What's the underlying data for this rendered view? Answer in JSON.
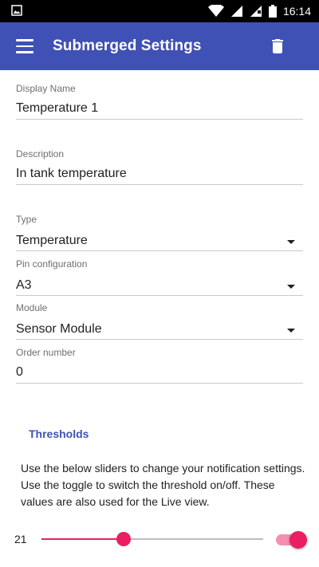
{
  "status_bar": {
    "time": "16:14"
  },
  "app_bar": {
    "title": "Submerged Settings",
    "menu_icon": "hamburger-menu-icon",
    "delete_icon": "trash-icon",
    "color": "#3f51b5"
  },
  "fields": {
    "display_name": {
      "label": "Display Name",
      "value": "Temperature 1"
    },
    "description": {
      "label": "Description",
      "value": "In tank temperature"
    },
    "type": {
      "label": "Type",
      "value": "Temperature"
    },
    "pin_configuration": {
      "label": "Pin configuration",
      "value": "A3"
    },
    "module": {
      "label": "Module",
      "value": "Sensor Module"
    },
    "order_number": {
      "label": "Order number",
      "value": "0"
    }
  },
  "thresholds": {
    "heading": "Thresholds",
    "help_text": "Use the below sliders to change your notification settings. Use the toggle to switch the threshold on/off. These values are also used for the Live view.",
    "slider": {
      "value": "21",
      "fraction": 0.37,
      "accent_color": "#e91e63"
    },
    "toggle": {
      "on": true
    }
  }
}
